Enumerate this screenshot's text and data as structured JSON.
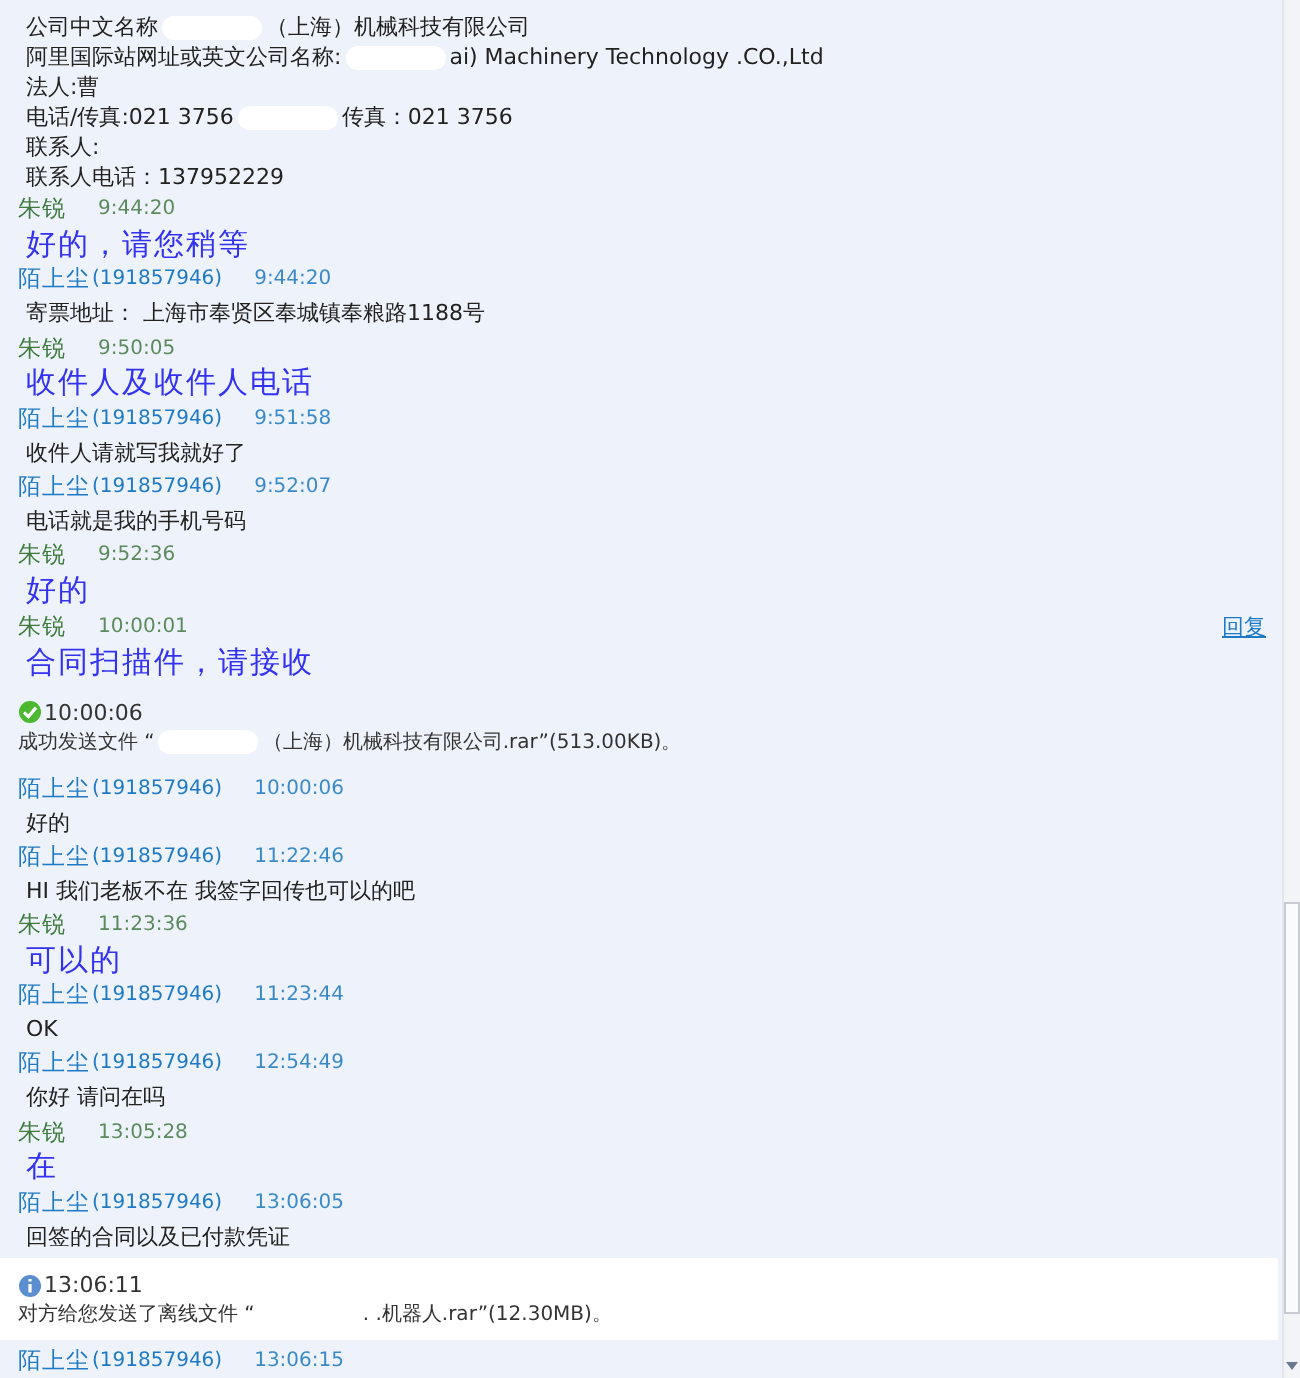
{
  "intro_lines": [
    {
      "parts": [
        "公司中文名称",
        "（上海）机械科技有限公司"
      ]
    },
    {
      "parts": [
        "阿里国际站网址或英文公司名称:",
        "ai) Machinery Technology .CO.,Ltd"
      ]
    },
    {
      "parts": [
        "法人:曹"
      ]
    },
    {
      "parts": [
        "电话/传真:021 3756",
        "传真：021 3756"
      ]
    },
    {
      "parts": [
        "联系人:"
      ]
    },
    {
      "parts": [
        "联系人电话：137952229"
      ]
    }
  ],
  "entries": [
    {
      "kind": "remote_message",
      "sender": "朱锐",
      "time": "9:44:20",
      "text": "好的，请您稍等"
    },
    {
      "kind": "local_message",
      "sender": "陌上尘",
      "qq": "(191857946)",
      "time": "9:44:20",
      "text": "寄票地址： 上海市奉贤区奉城镇奉粮路1188号"
    },
    {
      "kind": "remote_message",
      "sender": "朱锐",
      "time": "9:50:05",
      "text": "收件人及收件人电话"
    },
    {
      "kind": "local_message",
      "sender": "陌上尘",
      "qq": "(191857946)",
      "time": "9:51:58",
      "text": "收件人请就写我就好了"
    },
    {
      "kind": "local_message",
      "sender": "陌上尘",
      "qq": "(191857946)",
      "time": "9:52:07",
      "text": "电话就是我的手机号码"
    },
    {
      "kind": "remote_message",
      "sender": "朱锐",
      "time": "9:52:36",
      "text": "好的"
    },
    {
      "kind": "remote_message",
      "sender": "朱锐",
      "time": "10:00:01",
      "text": "合同扫描件，请接收",
      "reply_link": "回复"
    },
    {
      "kind": "sent_notice",
      "highlighted": false,
      "time": "10:00:06",
      "parts": [
        "成功发送文件 “",
        "（上海）机械科技有限公司.rar”(513.00KB)。"
      ]
    },
    {
      "kind": "local_message",
      "sender": "陌上尘",
      "qq": "(191857946)",
      "time": "10:00:06",
      "text": "好的"
    },
    {
      "kind": "local_message",
      "sender": "陌上尘",
      "qq": "(191857946)",
      "time": "11:22:46",
      "text": "HI 我们老板不在 我签字回传也可以的吧"
    },
    {
      "kind": "remote_message",
      "sender": "朱锐",
      "time": "11:23:36",
      "text": "可以的"
    },
    {
      "kind": "local_message",
      "sender": "陌上尘",
      "qq": "(191857946)",
      "time": "11:23:44",
      "text": "OK"
    },
    {
      "kind": "local_message",
      "sender": "陌上尘",
      "qq": "(191857946)",
      "time": "12:54:49",
      "text": "你好 请问在吗"
    },
    {
      "kind": "remote_message",
      "sender": "朱锐",
      "time": "13:05:28",
      "text": "在"
    },
    {
      "kind": "local_message",
      "sender": "陌上尘",
      "qq": "(191857946)",
      "time": "13:06:05",
      "text": "回签的合同以及已付款凭证"
    },
    {
      "kind": "received_notice",
      "highlighted": true,
      "time": "13:06:11",
      "parts": [
        "对方给您发送了离线文件 “",
        ". .机器人.rar”(12.30MB)。"
      ]
    },
    {
      "kind": "local_header",
      "sender": "陌上尘",
      "qq": "(191857946)",
      "time": "13:06:15"
    }
  ]
}
